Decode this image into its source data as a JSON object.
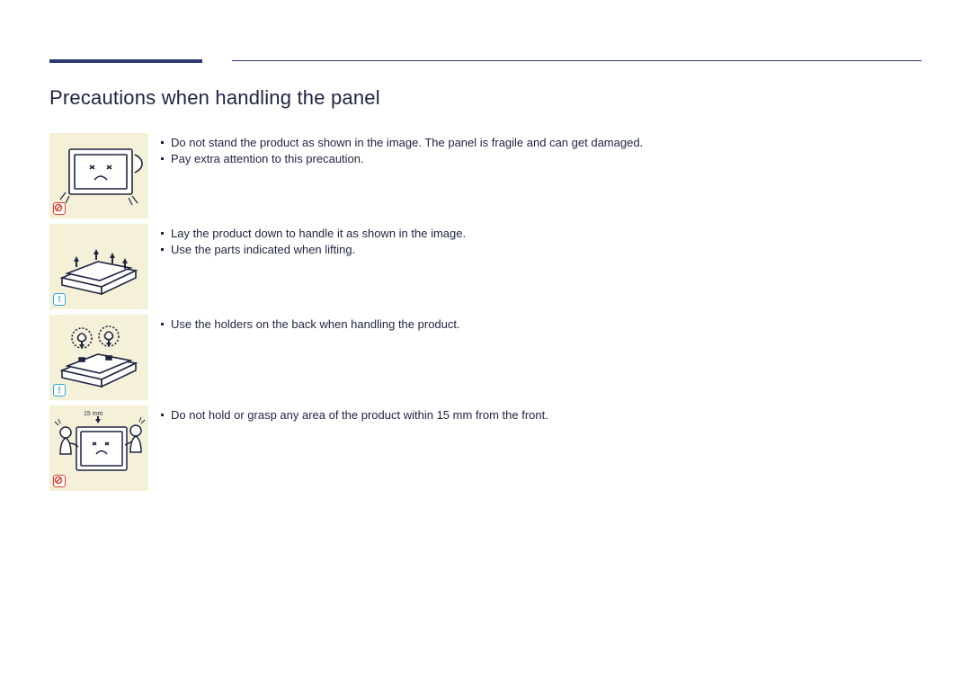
{
  "section_title": "Precautions when handling the panel",
  "precautions": [
    {
      "icon_type": "prohibit",
      "lines": [
        "Do not stand the product as shown in the image. The panel is fragile and can get damaged.",
        "Pay extra attention to this precaution."
      ]
    },
    {
      "icon_type": "caution",
      "lines": [
        "Lay the product down to handle it as shown in the image.",
        "Use the parts indicated when lifting."
      ]
    },
    {
      "icon_type": "caution",
      "lines": [
        "Use the holders on the back when handling the product."
      ]
    },
    {
      "icon_type": "prohibit",
      "lines": [
        "Do not hold or grasp any area of the product within 15 mm from the front."
      ]
    }
  ],
  "dim_label": "15 mm"
}
